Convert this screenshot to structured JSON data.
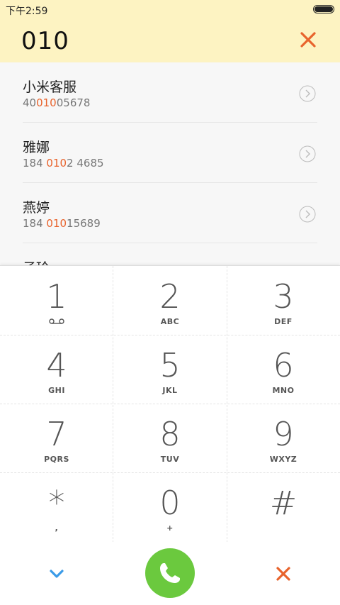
{
  "status_bar": {
    "time": "下午2:59",
    "battery_icon": "battery-icon"
  },
  "dialer": {
    "number": "010",
    "clear_icon": "close-icon",
    "accent_color": "#e8632c"
  },
  "contacts": [
    {
      "name": "小米客服",
      "number_pre": "40",
      "number_match": "010",
      "number_post": "05678"
    },
    {
      "name": "雅娜",
      "number_pre": "184 ",
      "number_match": "010",
      "number_post": "2 4685"
    },
    {
      "name": "燕婷",
      "number_pre": "184 ",
      "number_match": "010",
      "number_post": "15689"
    },
    {
      "name": "子玲",
      "number_pre": "",
      "number_match": "",
      "number_post": ""
    }
  ],
  "keypad": {
    "keys": [
      {
        "digit": "1",
        "letters": ""
      },
      {
        "digit": "2",
        "letters": "ABC"
      },
      {
        "digit": "3",
        "letters": "DEF"
      },
      {
        "digit": "4",
        "letters": "GHI"
      },
      {
        "digit": "5",
        "letters": "JKL"
      },
      {
        "digit": "6",
        "letters": "MNO"
      },
      {
        "digit": "7",
        "letters": "PQRS"
      },
      {
        "digit": "8",
        "letters": "TUV"
      },
      {
        "digit": "9",
        "letters": "WXYZ"
      },
      {
        "digit": "*",
        "letters": ","
      },
      {
        "digit": "0",
        "letters": "+"
      },
      {
        "digit": "#",
        "letters": ""
      }
    ]
  },
  "bottom_bar": {
    "collapse_icon": "chevron-down-icon",
    "call_icon": "phone-icon",
    "delete_icon": "close-icon",
    "call_color": "#6bc93e",
    "collapse_color": "#3a9be8",
    "delete_color": "#e8632c"
  }
}
